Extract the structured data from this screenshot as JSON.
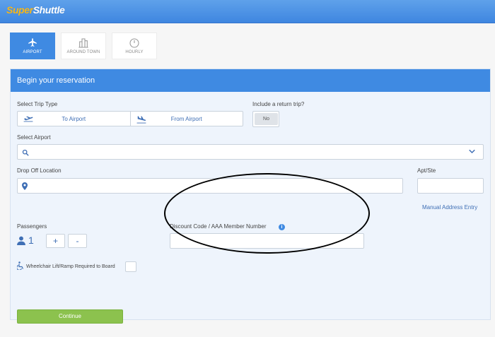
{
  "header": {
    "logo_text": "SuperShuttle",
    "logo_first": "Super",
    "logo_second": "Shuttle"
  },
  "service_tabs": [
    {
      "label": "AIRPORT",
      "icon": "airplane-icon",
      "active": true
    },
    {
      "label": "AROUND TOWN",
      "icon": "buildings-icon",
      "active": false
    },
    {
      "label": "HOURLY",
      "icon": "clock-icon",
      "active": false
    }
  ],
  "form": {
    "title": "Begin your reservation",
    "trip_type_label": "Select Trip Type",
    "trip_types": [
      "To Airport",
      "From Airport"
    ],
    "return_trip_label": "Include a return trip?",
    "return_trip_value": "No",
    "airport_label": "Select Airport",
    "airport_value": "",
    "dropoff_label": "Drop Off Location",
    "dropoff_value": "",
    "apt_label": "Apt/Ste",
    "apt_value": "",
    "manual_address_link": "Manual Address Entry",
    "passengers_label": "Passengers",
    "passengers_count": "1",
    "plus_label": "+",
    "minus_label": "-",
    "discount_label": "Discount Code / AAA Member Number",
    "info_glyph": "i",
    "discount_value": "",
    "wheelchair_label": "Wheelchair Lift/Ramp Required to Board",
    "continue_label": "Continue"
  },
  "colors": {
    "brand_blue": "#3f8ae2",
    "logo_yellow": "#f7b81b",
    "continue_green": "#8cc24e",
    "link_blue": "#3f6fb5"
  }
}
